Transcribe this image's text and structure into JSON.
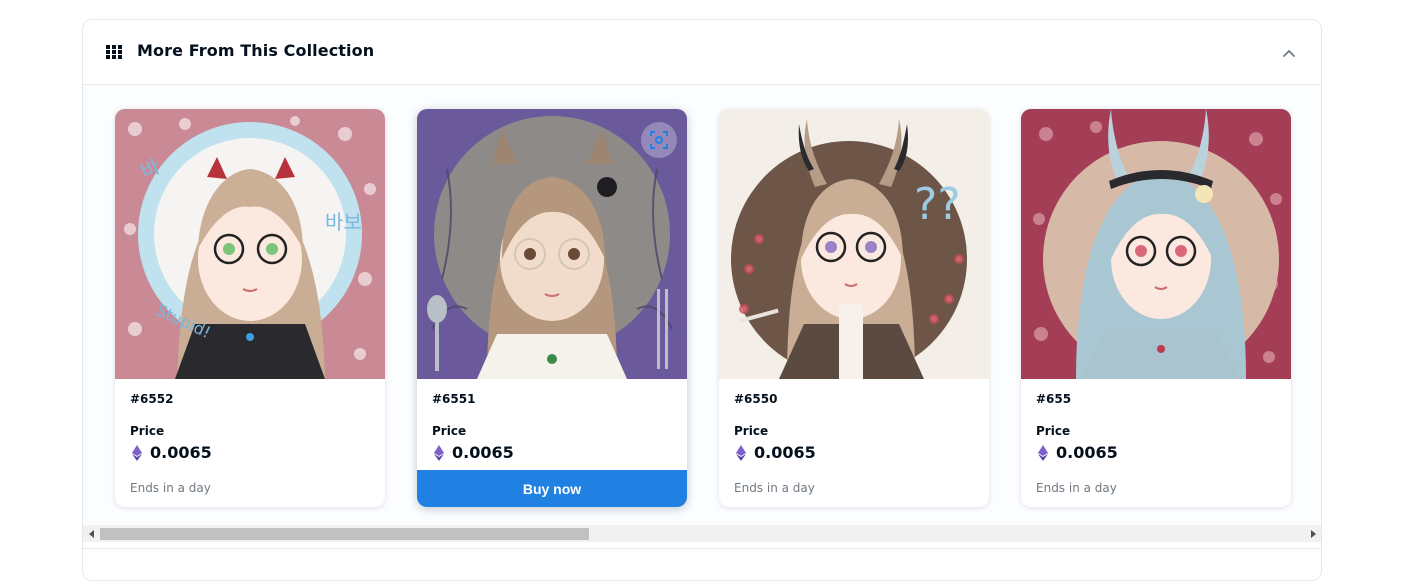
{
  "panel": {
    "title": "More From This Collection",
    "header_icon": "grid-icon",
    "collapse_icon": "chevron-up-icon"
  },
  "cards": [
    {
      "name": "#6552",
      "price_label": "Price",
      "price": "0.0065",
      "currency_icon": "ethereum-icon",
      "ends": "Ends in a day",
      "art_bg": "#c98a95"
    },
    {
      "name": "#6551",
      "price_label": "Price",
      "price": "0.0065",
      "currency_icon": "ethereum-icon",
      "ends": "",
      "buy_label": "Buy now",
      "art_bg": "#6a5a9c"
    },
    {
      "name": "#6550",
      "price_label": "Price",
      "price": "0.0065",
      "currency_icon": "ethereum-icon",
      "ends": "Ends in a day",
      "art_bg": "#f3efe8"
    },
    {
      "name": "#655",
      "price_label": "Price",
      "price": "0.0065",
      "currency_icon": "ethereum-icon",
      "ends": "Ends in a day",
      "art_bg": "#a43e56"
    }
  ],
  "colors": {
    "accent": "#2081e2",
    "eth": "#7b61c9",
    "muted": "#707a83"
  }
}
